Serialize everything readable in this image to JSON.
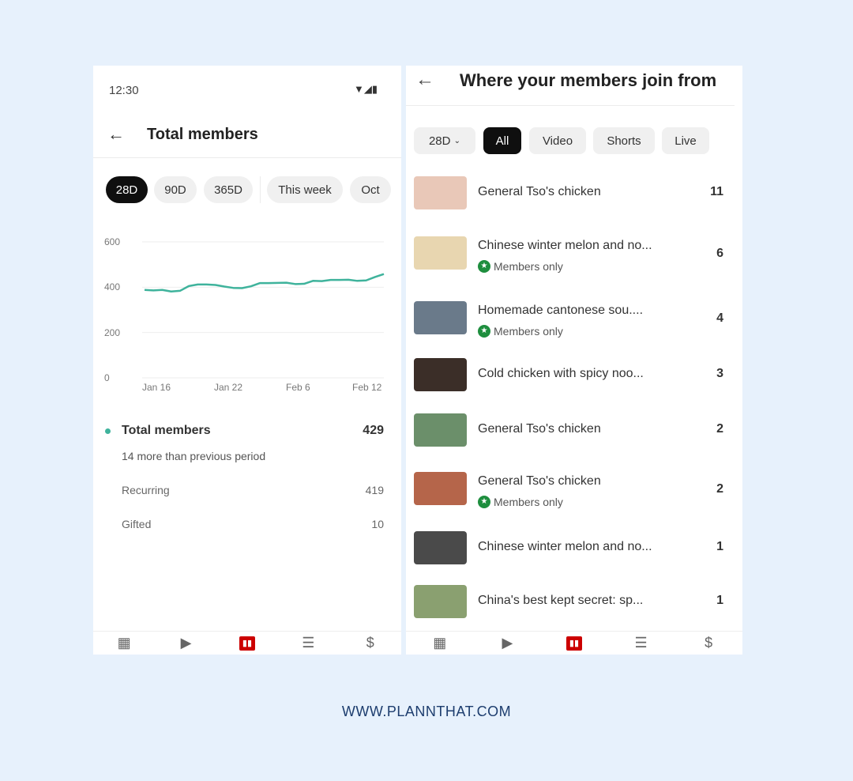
{
  "left": {
    "status_time": "12:30",
    "title": "Total members",
    "chips": [
      "28D",
      "90D",
      "365D",
      "This week",
      "Oct"
    ],
    "active_chip": 0,
    "summary": {
      "label": "Total members",
      "value": "429",
      "subtitle": "14 more than previous period"
    },
    "breakdown": [
      {
        "label": "Recurring",
        "value": "419"
      },
      {
        "label": "Gifted",
        "value": "10"
      }
    ]
  },
  "chart_data": {
    "type": "line",
    "yticks": [
      "0",
      "200",
      "400",
      "600"
    ],
    "ylim": [
      0,
      600
    ],
    "xticks": [
      "Jan 16",
      "Jan 22",
      "Feb 6",
      "Feb 12"
    ],
    "series": [
      {
        "color": "#3fb39c",
        "values": [
          388,
          386,
          388,
          381,
          384,
          405,
          412,
          412,
          410,
          403,
          397,
          396,
          404,
          418,
          418,
          419,
          420,
          414,
          415,
          428,
          427,
          432,
          432,
          433,
          428,
          430,
          445,
          458
        ]
      }
    ],
    "grid": true
  },
  "right": {
    "title": "Where your members join from",
    "chips": [
      "28D",
      "All",
      "Video",
      "Shorts",
      "Live"
    ],
    "active_chip": 1,
    "members_only_label": "Members only",
    "items": [
      {
        "title": "General Tso's chicken",
        "count": "11",
        "members_only": false,
        "color": "#e9c8b8"
      },
      {
        "title": "Chinese winter melon and no...",
        "count": "6",
        "members_only": true,
        "color": "#e8d6b0"
      },
      {
        "title": "Homemade cantonese sou....",
        "count": "4",
        "members_only": true,
        "color": "#6a7a8a"
      },
      {
        "title": "Cold chicken with spicy noo...",
        "count": "3",
        "members_only": false,
        "color": "#3b2e28"
      },
      {
        "title": "General Tso's chicken",
        "count": "2",
        "members_only": false,
        "color": "#6b8f6a"
      },
      {
        "title": "General Tso's chicken",
        "count": "2",
        "members_only": true,
        "color": "#b5654a"
      },
      {
        "title": "Chinese winter melon and no...",
        "count": "1",
        "members_only": false,
        "color": "#4a4a4a"
      },
      {
        "title": "China's best kept secret: sp...",
        "count": "1",
        "members_only": false,
        "color": "#8aa070"
      }
    ]
  },
  "nav_icons": [
    "dashboard-icon",
    "content-icon",
    "analytics-icon",
    "comments-icon",
    "earn-icon"
  ],
  "footer": "WWW.PLANNTHAT.COM"
}
